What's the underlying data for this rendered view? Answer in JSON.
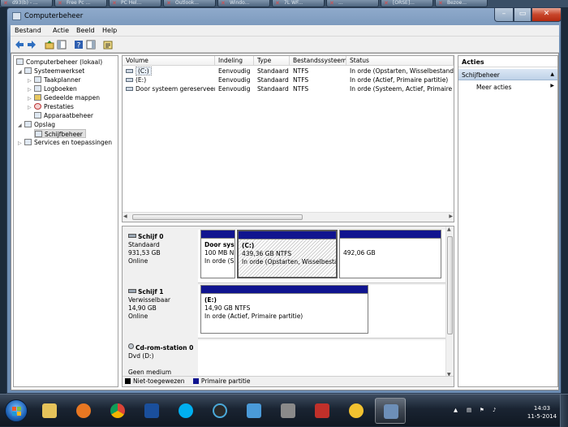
{
  "browser_tabs": [
    "d93(b) - ...",
    "Free Pc ...",
    "PC Hel...",
    "Outlook...",
    "Windo...",
    "7L WF...",
    "...",
    "[ORSE]...",
    "Bezoe..."
  ],
  "window": {
    "title": "Computerbeheer",
    "min": "–",
    "max": "▭",
    "close": "✕"
  },
  "menu": {
    "items": [
      "Bestand",
      "Actie",
      "Beeld",
      "Help"
    ]
  },
  "tree": {
    "root": "Computerbeheer (lokaal)",
    "system_tools": "Systeemwerkset",
    "task_scheduler": "Taakplanner",
    "event_viewer": "Logboeken",
    "shared_folders": "Gedeelde mappen",
    "performance": "Prestaties",
    "device_manager": "Apparaatbeheer",
    "storage": "Opslag",
    "disk_management": "Schijfbeheer",
    "services": "Services en toepassingen"
  },
  "volumes": {
    "headers": [
      "Volume",
      "Indeling",
      "Type",
      "Bestandssysteem",
      "Status"
    ],
    "rows": [
      {
        "volume": "(C:)",
        "layout": "Eenvoudig",
        "type": "Standaard",
        "fs": "NTFS",
        "status": "In orde (Opstarten, Wisselbestand, C"
      },
      {
        "volume": "(E:)",
        "layout": "Eenvoudig",
        "type": "Standaard",
        "fs": "NTFS",
        "status": "In orde (Actief, Primaire partitie)"
      },
      {
        "volume": "Door systeem gereserveerd",
        "layout": "Eenvoudig",
        "type": "Standaard",
        "fs": "NTFS",
        "status": "In orde (Systeem, Actief, Primaire pa"
      }
    ]
  },
  "disks": [
    {
      "name": "Schijf 0",
      "kind": "Standaard",
      "size": "931,53 GB",
      "state": "Online",
      "partitions": [
        {
          "title": "Door sys",
          "line1": "100 MB N",
          "line2": "In orde (S"
        },
        {
          "title": "(C:)",
          "line1": "439,36 GB NTFS",
          "line2": "In orde (Opstarten, Wisselbestar"
        },
        {
          "title": "",
          "line1": "492,06 GB",
          "line2": ""
        }
      ]
    },
    {
      "name": "Schijf 1",
      "kind": "Verwisselbaar",
      "size": "14,90 GB",
      "state": "Online",
      "partitions": [
        {
          "title": "(E:)",
          "line1": "14,90 GB NTFS",
          "line2": "In orde (Actief, Primaire partitie)"
        }
      ]
    },
    {
      "name": "Cd-rom-station 0",
      "kind": "Dvd (D:)",
      "size": "",
      "state": "Geen medium",
      "partitions": []
    }
  ],
  "legend": {
    "unallocated": "Niet-toegewezen",
    "primary": "Primaire partitie"
  },
  "actions": {
    "header": "Acties",
    "section": "Schijfbeheer",
    "more": "Meer acties"
  },
  "clock": {
    "time": "14:03",
    "date": "11-5-2014"
  },
  "colors": {
    "partition_bar": "#10148f",
    "selection": "#bfd2e8"
  }
}
